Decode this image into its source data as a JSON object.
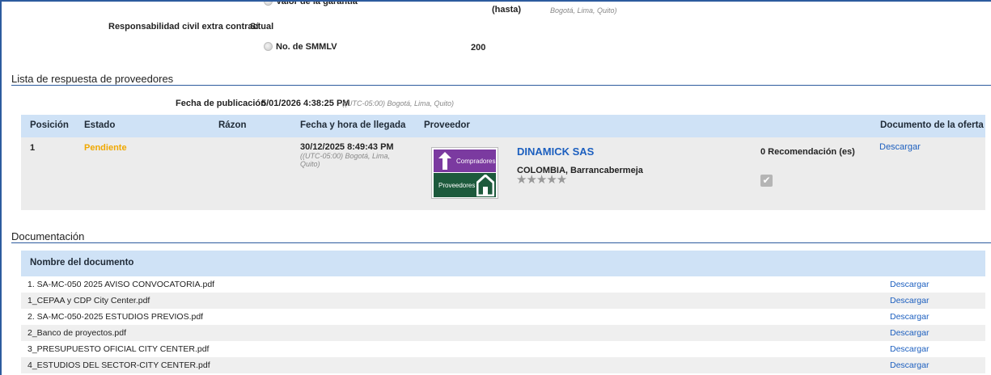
{
  "top": {
    "partial_option_label": "Valor de la garantía",
    "hasta_label": "(hasta)",
    "hasta_timezone": "Bogotá, Lima, Quito)",
    "rc_label": "Responsabilidad civil extra contractual",
    "rc_value": "Sí",
    "smmlv_label": "No. de SMMLV",
    "smmlv_value": "200"
  },
  "responses": {
    "section_title": "Lista de respuesta de proveedores",
    "publication_label": "Fecha de publicación",
    "publication_value": "5/01/2026 4:38:25 PM",
    "publication_tz": "((UTC-05:00) Bogotá, Lima, Quito)",
    "columns": {
      "posicion": "Posición",
      "estado": "Estado",
      "razon": "Rázon",
      "fecha": "Fecha y hora de llegada",
      "proveedor": "Proveedor",
      "documento": "Documento de la oferta"
    },
    "row": {
      "position": "1",
      "status": "Pendiente",
      "status_color": "#f0a800",
      "arrival_date": "30/12/2025 8:49:43 PM",
      "arrival_tz": "((UTC-05:00) Bogotá, Lima, Quito)",
      "logo_top": "Compradores",
      "logo_bottom": "Proveedores",
      "provider_name": "DINAMICK SAS",
      "provider_location": "COLOMBIA, Barrancabermeja",
      "rating_stars": "★★★★★",
      "recommendations": "0 Recomendación (es)",
      "download": "Descargar"
    }
  },
  "documents": {
    "section_title": "Documentación",
    "column_name": "Nombre del documento",
    "download_label": "Descargar",
    "items": [
      {
        "name": "1. SA-MC-050 2025 AVISO CONVOCATORIA.pdf"
      },
      {
        "name": "1_CEPAA y CDP City Center.pdf"
      },
      {
        "name": "2. SA-MC-050-2025 ESTUDIOS PREVIOS.pdf"
      },
      {
        "name": "2_Banco de proyectos.pdf"
      },
      {
        "name": "3_PRESUPUESTO OFICIAL CITY CENTER.pdf"
      },
      {
        "name": "4_ESTUDIOS DEL SECTOR-CITY CENTER.pdf"
      }
    ]
  }
}
